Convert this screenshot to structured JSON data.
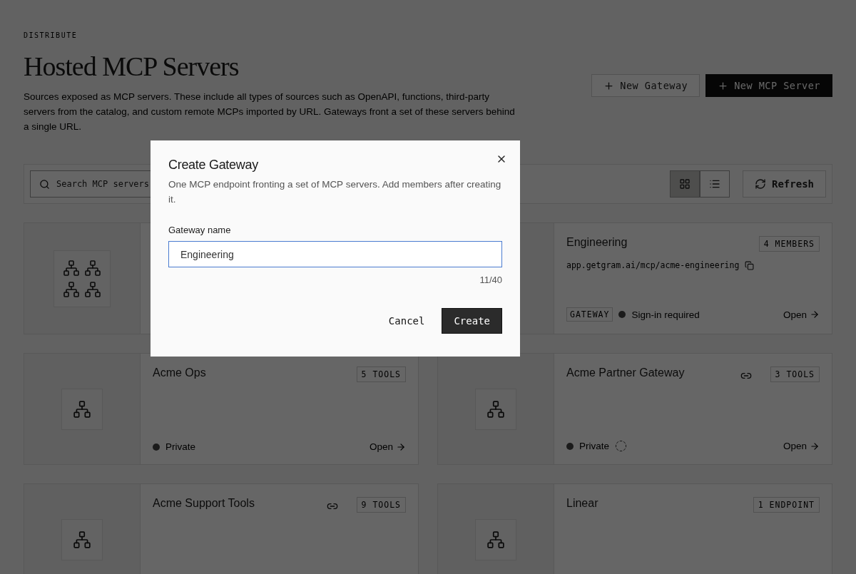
{
  "page": {
    "eyebrow": "DISTRIBUTE",
    "title": "Hosted MCP Servers",
    "description": "Sources exposed as MCP servers. These include all types of sources such as OpenAPI, functions, third-party servers from the catalog, and custom remote MCPs imported by URL. Gateways front a set of these servers behind a single URL.",
    "actions": [
      {
        "label": "New Gateway",
        "kind": "secondary"
      },
      {
        "label": "New MCP Server",
        "kind": "primary"
      }
    ]
  },
  "toolbar": {
    "search": {
      "placeholder": "Search MCP servers"
    },
    "views": [
      {
        "kind": "grid",
        "selected": true
      },
      {
        "kind": "list",
        "selected": false
      }
    ],
    "refresh": "Refresh"
  },
  "cards": [
    {
      "kind": "gateway",
      "linked": false,
      "pending": false
    },
    {
      "title": "Engineering",
      "count": "4 MEMBERS",
      "url": "app.getgram.ai/mcp/acme-engineering",
      "tag": "GATEWAY",
      "status": "Sign-in required",
      "open": "Open",
      "linked": false,
      "pending": false
    },
    {
      "kind": "server",
      "title": "Acme Ops",
      "count": "5 TOOLS",
      "status": "Private",
      "open": "Open",
      "linked": false,
      "pending": false
    },
    {
      "kind": "server",
      "title": "Acme Partner Gateway",
      "count": "3 TOOLS",
      "status": "Private",
      "open": "Open",
      "linked": true,
      "pending": true
    },
    {
      "kind": "server",
      "title": "Acme Support Tools",
      "count": "9 TOOLS",
      "linked": true,
      "pending": false
    },
    {
      "kind": "server",
      "title": "Linear",
      "count": "1 ENDPOINT",
      "linked": false,
      "pending": false
    }
  ],
  "dialog": {
    "title": "Create Gateway",
    "description": "One MCP endpoint fronting a set of MCP servers. Add members after creating it.",
    "field_label": "Gateway name",
    "value": "Engineering",
    "counter": "11/40",
    "cancel": "Cancel",
    "confirm": "Create"
  }
}
